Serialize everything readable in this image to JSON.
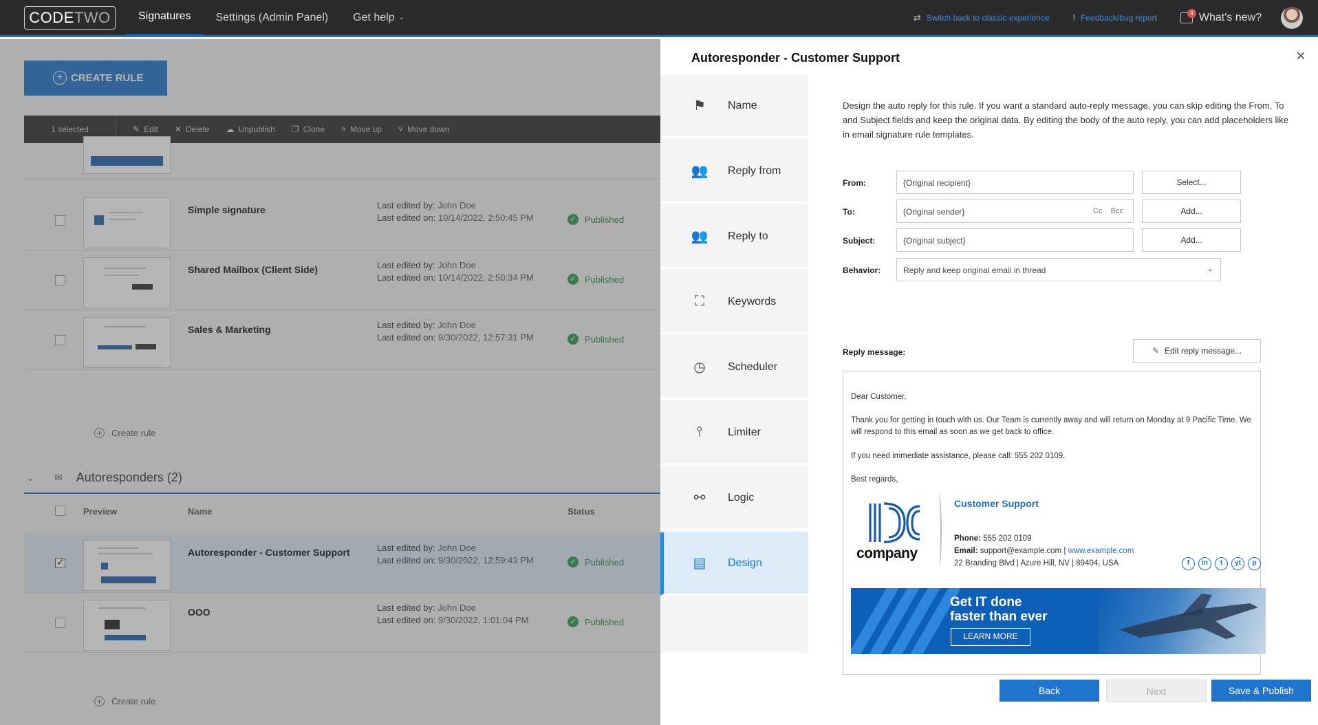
{
  "app": {
    "logo_part1": "CODE",
    "logo_part2": "TWO",
    "nav": [
      {
        "label": "Signatures"
      },
      {
        "label": "Settings (Admin Panel)"
      },
      {
        "label": "Get help"
      }
    ],
    "switch_classic": "Switch back to classic experience",
    "feedback": "Feedback/bug report",
    "whats_new": "What's new?",
    "whats_new_badge": "4"
  },
  "list": {
    "create_rule_button": "CREATE RULE",
    "toolbar": {
      "selected": "1 selected",
      "edit": "Edit",
      "delete": "Delete",
      "unpublish": "Unpublish",
      "clone": "Clone",
      "move_up": "Move up",
      "move_down": "Move down"
    },
    "signature_rows": [
      {
        "name": "Simple signature",
        "edited_by_label": "Last edited by:",
        "edited_by": "John Doe",
        "edited_on_label": "Last edited on:",
        "edited_on": "10/14/2022, 2:50:45 PM",
        "status": "Published"
      },
      {
        "name": "Shared Mailbox (Client Side)",
        "edited_by_label": "Last edited by:",
        "edited_by": "John Doe",
        "edited_on_label": "Last edited on:",
        "edited_on": "10/14/2022, 2:50:34 PM",
        "status": "Published"
      },
      {
        "name": "Sales & Marketing",
        "edited_by_label": "Last edited by:",
        "edited_by": "John Doe",
        "edited_on_label": "Last edited on:",
        "edited_on": "9/30/2022, 12:57:31 PM",
        "status": "Published"
      }
    ],
    "create_rule_link": "Create rule",
    "group_title": "Autoresponders (2)",
    "columns": {
      "preview": "Preview",
      "name": "Name",
      "status": "Status"
    },
    "autoresponder_rows": [
      {
        "name": "Autoresponder - Customer Support",
        "edited_by_label": "Last edited by:",
        "edited_by": "John Doe",
        "edited_on_label": "Last edited on:",
        "edited_on": "9/30/2022, 12:59:43 PM",
        "status": "Published",
        "checked": true
      },
      {
        "name": "OOO",
        "edited_by_label": "Last edited by:",
        "edited_by": "John Doe",
        "edited_on_label": "Last edited on:",
        "edited_on": "9/30/2022, 1:01:04 PM",
        "status": "Published",
        "checked": false
      }
    ]
  },
  "dialog": {
    "title": "Autoresponder - Customer Support",
    "steps": [
      {
        "label": "Name",
        "icon": "signpost-icon"
      },
      {
        "label": "Reply from",
        "icon": "users-from-icon"
      },
      {
        "label": "Reply to",
        "icon": "users-to-icon"
      },
      {
        "label": "Keywords",
        "icon": "keywords-icon"
      },
      {
        "label": "Scheduler",
        "icon": "clock-icon"
      },
      {
        "label": "Limiter",
        "icon": "limiter-icon"
      },
      {
        "label": "Logic",
        "icon": "logic-icon"
      },
      {
        "label": "Design",
        "icon": "design-icon",
        "active": true
      }
    ],
    "intro": "Design the auto reply for this rule. If you want a standard auto-reply message, you can skip editing the From, To and Subject fields and keep the original data. By editing the body of the auto reply, you can add placeholders like in email signature rule templates.",
    "from_label": "From:",
    "from_value": "{Original recipient}",
    "from_button": "Select...",
    "to_label": "To:",
    "to_value": "{Original sender}",
    "cc": "Cc",
    "bcc": "Bcc",
    "to_button": "Add...",
    "subject_label": "Subject:",
    "subject_value": "{Original subject}",
    "subject_button": "Add...",
    "behavior_label": "Behavior:",
    "behavior_value": "Reply and keep original email in thread",
    "reply_message_label": "Reply message:",
    "edit_reply_button": "Edit reply message...",
    "message": {
      "greeting": "Dear Customer,",
      "p1": "Thank you for getting in touch with us. Our Team is currently away and will return on Monday at 9 Pacific Time. We will respond to this email as soon as we get back to office.",
      "p2": "If you need immediate assistance, please call: 555 202 0109.",
      "closing": "Best regards,"
    },
    "signature": {
      "logo_word": "company",
      "name": "Customer Support",
      "phone_label": "Phone:",
      "phone": "555 202 0109",
      "email_label": "Email:",
      "email": "support@example.com |",
      "website": "www.example.com",
      "address": "22 Branding Blvd | Azure Hill, NV | 89404, USA",
      "social": [
        "f",
        "in",
        "t",
        "yt",
        "p"
      ],
      "banner_line1": "Get IT done",
      "banner_line2": "faster than ever",
      "banner_button": "LEARN MORE"
    },
    "back_button": "Back",
    "next_button": "Next",
    "save_button": "Save & Publish"
  },
  "colors": {
    "accent": "#1f74cc",
    "published": "#2b9a4a",
    "topbar": "#2b2b2b"
  }
}
